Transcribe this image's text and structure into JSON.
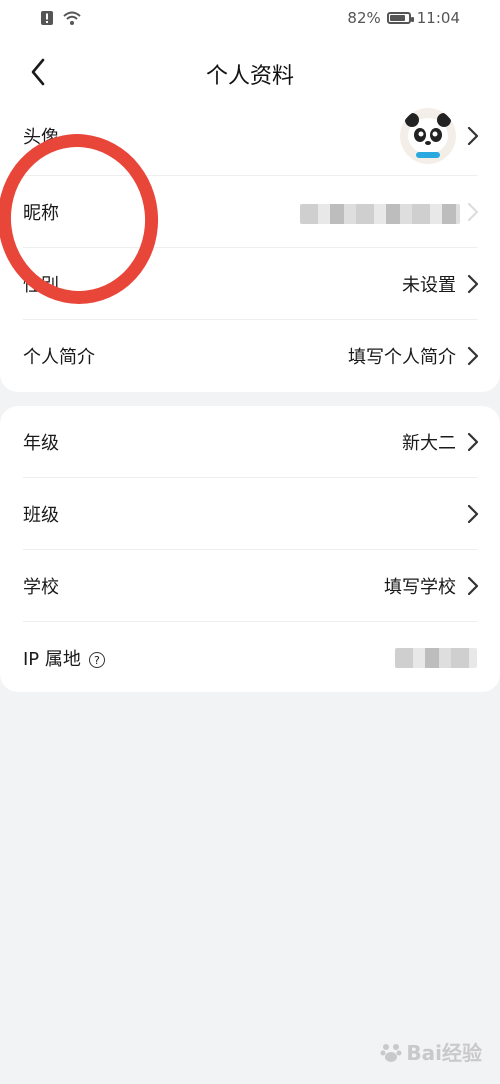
{
  "status_bar": {
    "battery": "82%",
    "time": "11:04",
    "battery_level": 0.82
  },
  "nav": {
    "title": "个人资料"
  },
  "profile": [
    {
      "key": "avatar",
      "label": "头像"
    },
    {
      "key": "nickname",
      "label": "昵称"
    },
    {
      "key": "gender",
      "label": "性别",
      "value": "未设置"
    },
    {
      "key": "bio",
      "label": "个人简介",
      "value": "填写个人简介"
    }
  ],
  "education": [
    {
      "key": "grade",
      "label": "年级",
      "value": "新大二"
    },
    {
      "key": "class",
      "label": "班级"
    },
    {
      "key": "school",
      "label": "学校",
      "value": "填写学校"
    },
    {
      "key": "ip",
      "label": "IP 属地"
    }
  ],
  "icons": {
    "back": "back-arrow-icon",
    "chevron": "chevron-right-icon",
    "help": "question-circle-icon",
    "wifi": "wifi-icon",
    "alert": "alert-icon",
    "battery": "battery-icon"
  },
  "watermark": {
    "text": "Bai经验"
  },
  "colors": {
    "annotation": "#e9463a",
    "background": "#f2f3f5"
  }
}
